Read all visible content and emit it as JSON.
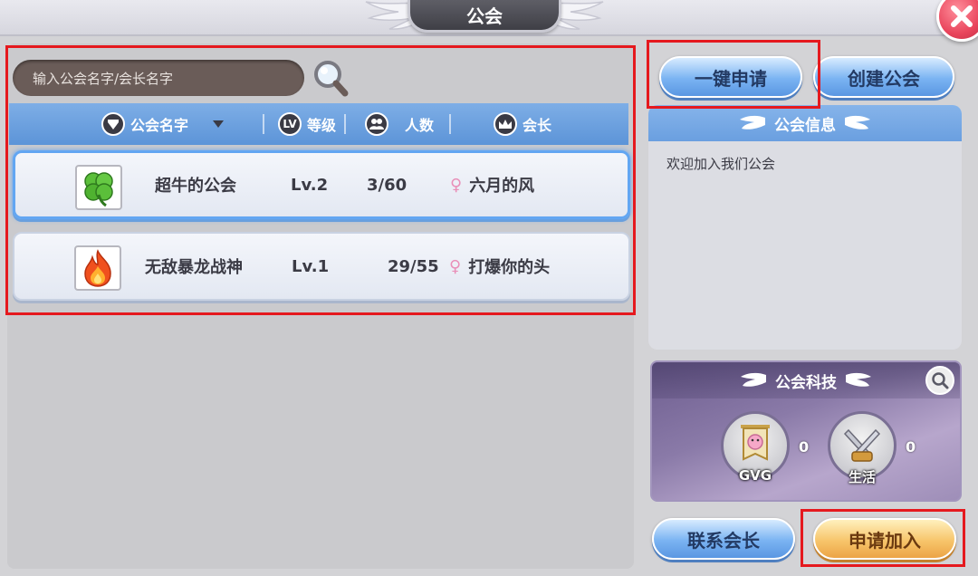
{
  "window": {
    "title": "公会"
  },
  "search": {
    "placeholder": "输入公会名字/会长名字"
  },
  "table": {
    "headers": {
      "name": "公会名字",
      "level_badge": "LV",
      "level": "等级",
      "members": "人数",
      "leader": "会长"
    },
    "rows": [
      {
        "emblem": "clover-icon",
        "name": "超牛的公会",
        "level": "Lv.2",
        "members": "3/60",
        "leader": "六月的风",
        "selected": true
      },
      {
        "emblem": "fire-icon",
        "name": "无敌暴龙战神",
        "level": "Lv.1",
        "members": "29/55",
        "leader": "打爆你的头",
        "selected": false
      }
    ]
  },
  "actions": {
    "quick_apply": "一键申请",
    "create_guild": "创建公会",
    "contact_leader": "联系会长",
    "apply_join": "申请加入"
  },
  "guild_info": {
    "title": "公会信息",
    "message": "欢迎加入我们公会"
  },
  "guild_tech": {
    "title": "公会科技",
    "items": [
      {
        "label": "GVG",
        "count": "0",
        "icon": "gvg-banner-icon"
      },
      {
        "label": "生活",
        "count": "0",
        "icon": "life-swords-icon"
      }
    ]
  },
  "colors": {
    "highlight": "#e5191e",
    "header_blue": "#5c94d8",
    "button_blue": "#7ab3f2",
    "button_gold": "#f7c56b",
    "leader_gender": "#e98fb8"
  }
}
